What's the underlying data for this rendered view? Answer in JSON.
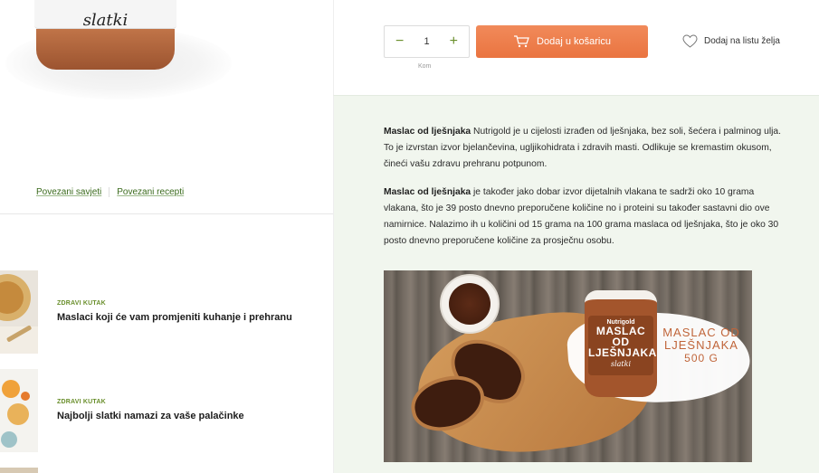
{
  "product": {
    "brand_script": "slatki",
    "unit_label": "Kom",
    "quantity": "1",
    "minus": "−",
    "plus": "+",
    "add_to_cart": "Dodaj u košaricu",
    "wishlist": "Dodaj na listu želja",
    "colors": {
      "accent_orange": "#ea7440",
      "accent_green": "#6a8f2c",
      "body_bg": "#f1f6ee"
    }
  },
  "related": {
    "tips_link": "Povezani savjeti",
    "recipes_link": "Povezani recepti"
  },
  "articles": [
    {
      "category": "ZDRAVI KUTAK",
      "title": "Maslaci koji će vam promjeniti kuhanje i prehranu"
    },
    {
      "category": "ZDRAVI KUTAK",
      "title": "Najbolji slatki namazi za vaše palačinke"
    }
  ],
  "description": {
    "p1_bold": "Maslac od lješnjaka",
    "p1_text": " Nutrigold je u cijelosti izrađen od lješnjaka, bez soli, šećera i palminog ulja. To je izvrstan izvor bjelančevina, ugljikohidrata i zdravih masti. Odlikuje se kremastim okusom, čineći vašu zdravu prehranu potpunom.",
    "p2_bold": "Maslac od lješnjaka",
    "p2_text": " je također jako dobar izvor dijetalnih vlakana te sadrži oko 10 grama vlakana, što je 39 posto dnevno preporučene količine no i proteini su također sastavni dio ove namirnice. Nalazimo ih u količini od 15 grama na 100 grama maslaca od lješnjaka, što je oko 30 posto dnevno preporučene količine za prosječnu osobu."
  },
  "promo": {
    "jar_brand": "Nutrigold",
    "jar_name_1": "MASLAC OD",
    "jar_name_2": "LJEŠNJAKA",
    "jar_script": "slatki",
    "side_line_1": "MASLAC OD",
    "side_line_2": "LJEŠNJAKA",
    "side_size": "500 G"
  }
}
